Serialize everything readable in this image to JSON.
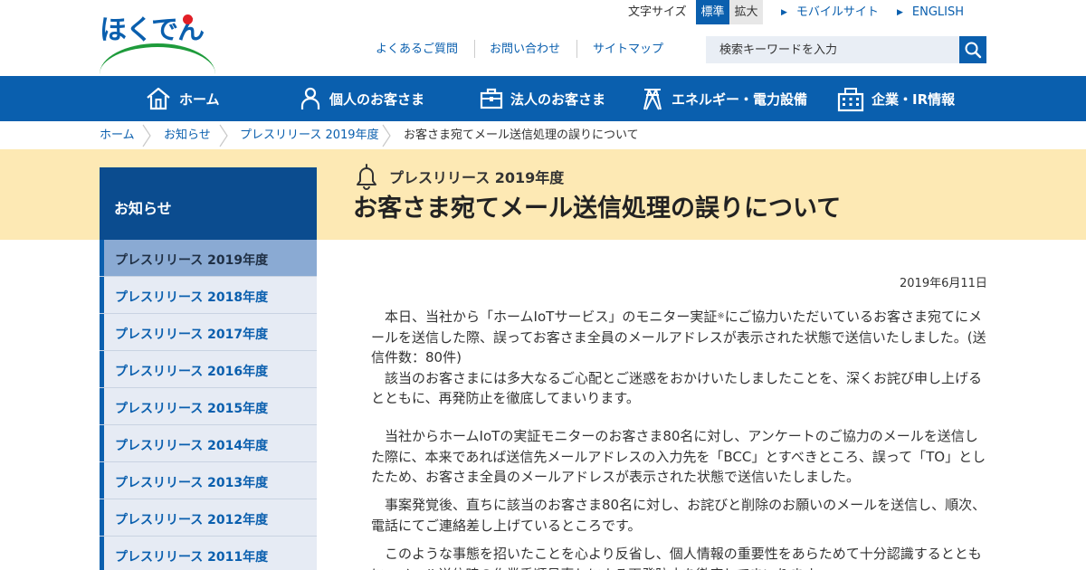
{
  "header": {
    "logo_text": "ほくでん",
    "font_size_label": "文字サイズ",
    "font_standard": "標準",
    "font_large": "拡大",
    "mobile_link": "モバイルサイト",
    "english_link": "ENGLISH",
    "faq": "よくあるご質問",
    "contact": "お問い合わせ",
    "sitemap": "サイトマップ",
    "search_placeholder": "検索キーワードを入力"
  },
  "nav": {
    "home": "ホーム",
    "personal": "個人のお客さま",
    "corporate": "法人のお客さま",
    "energy": "エネルギー・電力設備",
    "company": "企業・IR情報"
  },
  "breadcrumb": [
    "ホーム",
    "お知らせ",
    "プレスリリース 2019年度",
    "お客さま宛てメール送信処理の誤りについて"
  ],
  "page": {
    "category": "プレスリリース 2019年度",
    "title": "お客さま宛てメール送信処理の誤りについて",
    "date": "2019年6月11日"
  },
  "sidebar": {
    "heading": "お知らせ",
    "items": [
      "プレスリリース 2019年度",
      "プレスリリース 2018年度",
      "プレスリリース 2017年度",
      "プレスリリース 2016年度",
      "プレスリリース 2015年度",
      "プレスリリース 2014年度",
      "プレスリリース 2013年度",
      "プレスリリース 2012年度",
      "プレスリリース 2011年度"
    ],
    "active_index": 0
  },
  "article": {
    "p1_a": "　本日、当社から「ホームIoTサービス」のモニター実証",
    "p1_note": "※",
    "p1_b": "にご協力いただいているお客さま宛てにメールを送信した際、誤ってお客さま全員のメールアドレスが表示された状態で送信いたしました。(送信件数：80件)",
    "p1_c": "　該当のお客さまには多大なるご心配とご迷惑をおかけいたしましたことを、深くお詫び申し上げるとともに、再発防止を徹底してまいります。",
    "p2": "　当社からホームIoTの実証モニターのお客さま80名に対し、アンケートのご協力のメールを送信した際に、本来であれば送信先メールアドレスの入力先を「BCC」とすべきところ、誤って「TO」としたため、お客さま全員のメールアドレスが表示された状態で送信いたしました。",
    "p3": "　事案発覚後、直ちに該当のお客さま80名に対し、お詫びと削除のお願いのメールを送信し、順次、電話にてご連絡差し上げているところです。",
    "p4": "　このような事態を招いたことを心より反省し、個人情報の重要性をあらためて十分認識するとともに、メール送信時の作業手順見直しによる再発防止を徹底してまいります。"
  },
  "colors": {
    "brand_blue": "#0a5fae",
    "title_band": "#fde9b4",
    "side_head": "#0b4c8f",
    "side_active": "#8aaad3"
  }
}
